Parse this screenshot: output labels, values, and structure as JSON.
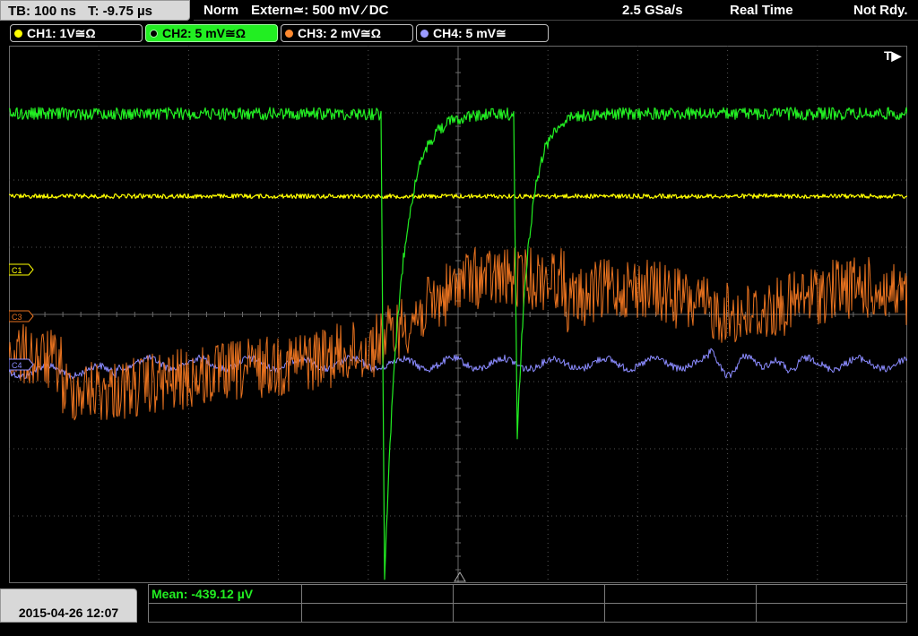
{
  "status_bar": {
    "timebase": "TB: 100 ns",
    "trigger_time": "T: -9.75 µs",
    "mode": "Norm",
    "trigger": "Extern≃: 500 mV ⁄ DC",
    "sample_rate": "2.5 GSa/s",
    "acquisition": "Real Time",
    "state": "Not Rdy."
  },
  "channels": [
    {
      "label": "CH1: 1V≅Ω",
      "color": "#ffff00",
      "active": false
    },
    {
      "label": "CH2: 5 mV≅Ω",
      "color": "#22ee22",
      "active": true
    },
    {
      "label": "CH3: 2 mV≅Ω",
      "color": "#ff8a30",
      "active": false
    },
    {
      "label": "CH4: 5 mV≅",
      "color": "#9a9aff",
      "active": false
    }
  ],
  "plot": {
    "trigger_marker": "T▶",
    "markers": [
      "C1",
      "C3",
      "C4"
    ],
    "colors": {
      "grid": "#555555",
      "ch1": "#ffff00",
      "ch2": "#22ee22",
      "ch3": "#e8721f",
      "ch4": "#8b8bff"
    }
  },
  "footer": {
    "datetime": "2015-04-26 12:07",
    "measurement": "Mean: -439.12 µV"
  }
}
